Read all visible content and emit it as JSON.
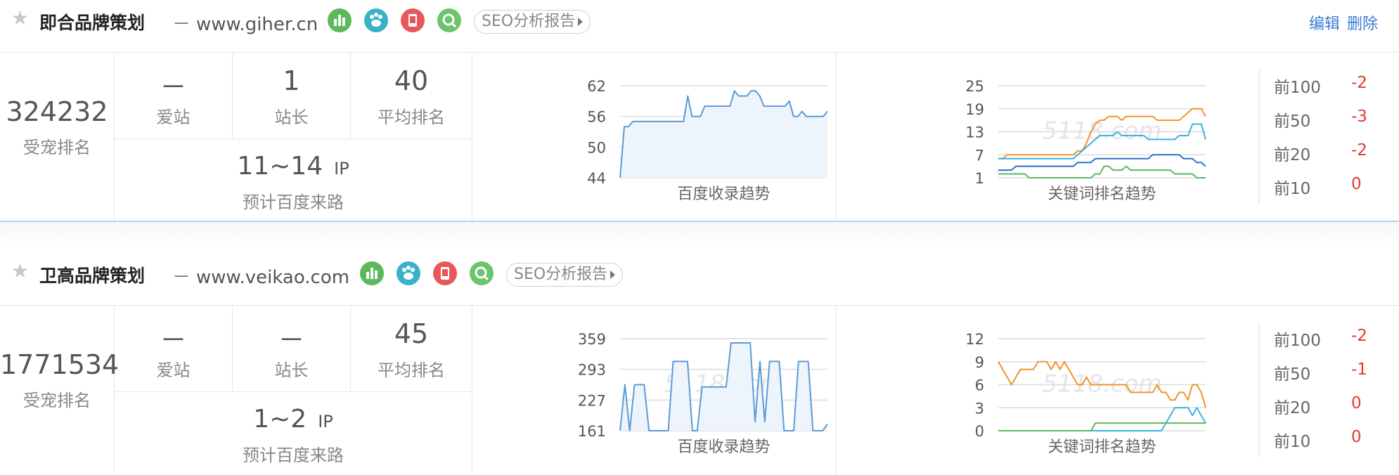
{
  "colors": {
    "accent": "#3a7bd5",
    "delta_red": "#e53935",
    "chart_blue": "#5b9bd5",
    "kw_orange": "#f0932b",
    "kw_sky": "#3bb0e0",
    "kw_blue": "#2f6fc9",
    "kw_green": "#5cb85c"
  },
  "sites": [
    {
      "name": "即合品牌策划",
      "url": "www.giher.cn",
      "dash": "－",
      "icons": [
        "stats-icon",
        "baidu-paw-icon",
        "mobile-icon",
        "search-q-icon"
      ],
      "seo_label": "SEO分析报告",
      "actions": {
        "edit": "编辑",
        "delete": "删除"
      },
      "pet_rank": {
        "value": "324232",
        "label": "受宠排名"
      },
      "stats": [
        {
          "value": "－",
          "label": "爱站"
        },
        {
          "value": "1",
          "label": "站长"
        },
        {
          "value": "40",
          "label": "平均排名"
        }
      ],
      "traffic": {
        "value": "11~14",
        "unit": "IP",
        "label": "预计百度来路"
      },
      "index_chart": {
        "title": "百度收录趋势",
        "watermark": "5118.com",
        "chart_data": {
          "type": "area",
          "yticks": [
            62,
            56,
            50,
            44
          ],
          "ylim": [
            44,
            62
          ],
          "values": [
            44,
            54,
            54,
            55,
            55,
            55,
            55,
            55,
            55,
            55,
            55,
            55,
            55,
            55,
            55,
            55,
            60,
            56,
            56,
            56,
            58,
            58,
            58,
            58,
            58,
            58,
            58,
            61,
            60,
            60,
            60,
            61,
            61,
            60,
            58,
            58,
            58,
            58,
            58,
            58,
            59,
            56,
            56,
            57,
            56,
            56,
            56,
            56,
            56,
            57
          ]
        }
      },
      "kw_chart": {
        "title": "关键词排名趋势",
        "watermark": "5118.com",
        "chart_data": {
          "type": "line",
          "yticks": [
            25,
            19,
            13,
            7,
            1
          ],
          "ylim": [
            1,
            25
          ],
          "series": [
            {
              "name": "前100",
              "color": "#f0932b",
              "values": [
                6,
                6,
                7,
                7,
                7,
                7,
                7,
                7,
                7,
                7,
                7,
                7,
                7,
                7,
                7,
                7,
                7,
                7,
                8,
                8,
                10,
                13,
                15,
                16,
                16,
                17,
                17,
                17,
                16,
                17,
                17,
                17,
                17,
                17,
                17,
                17,
                16,
                16,
                16,
                16,
                16,
                16,
                17,
                18,
                19,
                19,
                19,
                17
              ]
            },
            {
              "name": "前50",
              "color": "#3bb0e0",
              "values": [
                6,
                6,
                6,
                6,
                6,
                6,
                6,
                6,
                6,
                6,
                6,
                6,
                6,
                6,
                6,
                6,
                6,
                6,
                7,
                8,
                9,
                10,
                11,
                12,
                12,
                12,
                12,
                13,
                12,
                12,
                12,
                12,
                12,
                12,
                11,
                11,
                11,
                11,
                11,
                11,
                11,
                12,
                12,
                12,
                15,
                15,
                15,
                11
              ]
            },
            {
              "name": "前20",
              "color": "#2f6fc9",
              "values": [
                3,
                3,
                3,
                3,
                4,
                4,
                4,
                4,
                4,
                4,
                4,
                4,
                4,
                4,
                4,
                4,
                4,
                4,
                5,
                5,
                5,
                5,
                6,
                6,
                6,
                6,
                6,
                6,
                6,
                6,
                6,
                6,
                6,
                6,
                6,
                7,
                7,
                7,
                7,
                7,
                7,
                7,
                6,
                6,
                6,
                5,
                5,
                4
              ]
            },
            {
              "name": "前10",
              "color": "#5cb85c",
              "values": [
                2,
                2,
                2,
                2,
                2,
                2,
                2,
                1,
                1,
                1,
                1,
                1,
                1,
                1,
                1,
                1,
                1,
                1,
                1,
                1,
                1,
                1,
                2,
                2,
                4,
                4,
                3,
                3,
                3,
                4,
                3,
                3,
                3,
                3,
                3,
                3,
                3,
                3,
                3,
                3,
                2,
                2,
                2,
                2,
                2,
                1,
                1,
                1
              ]
            }
          ]
        }
      },
      "rank_changes": [
        {
          "label": "前100",
          "delta": "-2"
        },
        {
          "label": "前50",
          "delta": "-3"
        },
        {
          "label": "前20",
          "delta": "-2"
        },
        {
          "label": "前10",
          "delta": "0"
        }
      ]
    },
    {
      "name": "卫高品牌策划",
      "url": "www.veikao.com",
      "dash": "－",
      "icons": [
        "stats-icon",
        "baidu-paw-icon",
        "mobile-icon",
        "search-q-icon"
      ],
      "seo_label": "SEO分析报告",
      "actions": {
        "edit": "",
        "delete": ""
      },
      "pet_rank": {
        "value": "1771534",
        "label": "受宠排名"
      },
      "stats": [
        {
          "value": "－",
          "label": "爱站"
        },
        {
          "value": "－",
          "label": "站长"
        },
        {
          "value": "45",
          "label": "平均排名"
        }
      ],
      "traffic": {
        "value": "1~2",
        "unit": "IP",
        "label": "预计百度来路"
      },
      "index_chart": {
        "title": "百度收录趋势",
        "watermark": "5118.com",
        "chart_data": {
          "type": "area",
          "yticks": [
            359,
            293,
            227,
            161
          ],
          "ylim": [
            161,
            359
          ],
          "values": [
            161,
            260,
            161,
            260,
            260,
            260,
            161,
            161,
            161,
            161,
            161,
            310,
            310,
            310,
            310,
            161,
            161,
            255,
            255,
            255,
            255,
            255,
            255,
            350,
            350,
            350,
            350,
            350,
            180,
            310,
            180,
            310,
            310,
            310,
            161,
            161,
            161,
            310,
            310,
            310,
            161,
            161,
            161,
            175
          ]
        }
      },
      "kw_chart": {
        "title": "关键词排名趋势",
        "watermark": "5118.com",
        "chart_data": {
          "type": "line",
          "yticks": [
            12,
            9,
            6,
            3,
            0
          ],
          "ylim": [
            0,
            12
          ],
          "series": [
            {
              "name": "前100",
              "color": "#f0932b",
              "values": [
                9,
                8,
                7,
                6,
                7,
                8,
                8,
                8,
                8,
                9,
                9,
                9,
                8,
                9,
                8,
                9,
                8,
                7,
                6,
                6,
                7,
                6,
                6,
                6,
                6,
                6,
                6,
                6,
                6,
                6,
                5,
                5,
                5,
                5,
                5,
                5,
                6,
                5,
                5,
                4,
                4,
                5,
                5,
                4,
                6,
                6,
                5,
                3
              ]
            },
            {
              "name": "前50",
              "color": "#3bb0e0",
              "values": [
                0,
                0,
                0,
                0,
                0,
                0,
                0,
                0,
                0,
                0,
                0,
                0,
                0,
                0,
                0,
                0,
                0,
                0,
                0,
                0,
                0,
                0,
                0,
                0,
                0,
                0,
                0,
                0,
                0,
                0,
                0,
                0,
                0,
                0,
                0,
                0,
                0,
                0,
                1,
                2,
                3,
                3,
                3,
                3,
                2,
                3,
                2,
                1
              ]
            },
            {
              "name": "前10",
              "color": "#5cb85c",
              "values": [
                0,
                0,
                0,
                0,
                0,
                0,
                0,
                0,
                0,
                0,
                0,
                0,
                0,
                0,
                0,
                0,
                0,
                0,
                0,
                0,
                0,
                0,
                1,
                1,
                1,
                1,
                1,
                1,
                1,
                1,
                1,
                1,
                1,
                1,
                1,
                1,
                1,
                1,
                1,
                1,
                1,
                1,
                1,
                1,
                1,
                1,
                1,
                1
              ]
            }
          ]
        }
      },
      "rank_changes": [
        {
          "label": "前100",
          "delta": "-2"
        },
        {
          "label": "前50",
          "delta": "-1"
        },
        {
          "label": "前20",
          "delta": "0"
        },
        {
          "label": "前10",
          "delta": "0"
        }
      ]
    }
  ]
}
